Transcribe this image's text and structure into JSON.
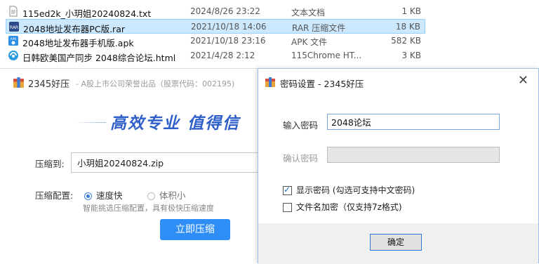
{
  "files": [
    {
      "name": "115ed2k_小玥姐20240824.txt",
      "date": "2024/8/26 23:22",
      "type": "文本文档",
      "size": "1 KB",
      "icon": "text-file-icon",
      "selected": false
    },
    {
      "name": "2048地址发布器PC版.rar",
      "date": "2021/10/18 14:06",
      "type": "RAR 压缩文件",
      "size": "18 KB",
      "icon": "rar-file-icon",
      "selected": true
    },
    {
      "name": "2048地址发布器手机版.apk",
      "date": "2021/10/18 23:16",
      "type": "APK 文件",
      "size": "582 KB",
      "icon": "apk-file-icon",
      "selected": false
    },
    {
      "name": "日韩欧美国产同步 2048综合论坛.html",
      "date": "2021/4/28 2:12",
      "type": "115Chrome HT...",
      "size": "3 KB",
      "icon": "html-file-icon",
      "selected": false
    }
  ],
  "main": {
    "app_name": "2345好压",
    "subtitle": "- A股上市公司荣誉出品（股票代码：002195)",
    "slogan": "高效专业  值得信",
    "path_label": "压缩到:",
    "path_value": "小玥姐20240824.zip",
    "config_label": "压缩配置:",
    "radio_fast": "速度快",
    "radio_small": "体积小",
    "hint": "智能挑选压缩配置，具有极快压缩速度",
    "compress_button": "立即压缩"
  },
  "dialog": {
    "title": "密码设置 - 2345好压",
    "close": "✕",
    "password_label": "输入密码",
    "password_value": "2048论坛",
    "confirm_label": "确认密码",
    "show_password": "显示密码 (勾选可支持中文密码)",
    "encrypt_names": "文件名加密（仅支持7z格式)",
    "ok_button": "确定"
  },
  "colors": {
    "accent": "#2e8ef5",
    "selection": "#cce8ff",
    "slogan": "#2f5fc8"
  }
}
